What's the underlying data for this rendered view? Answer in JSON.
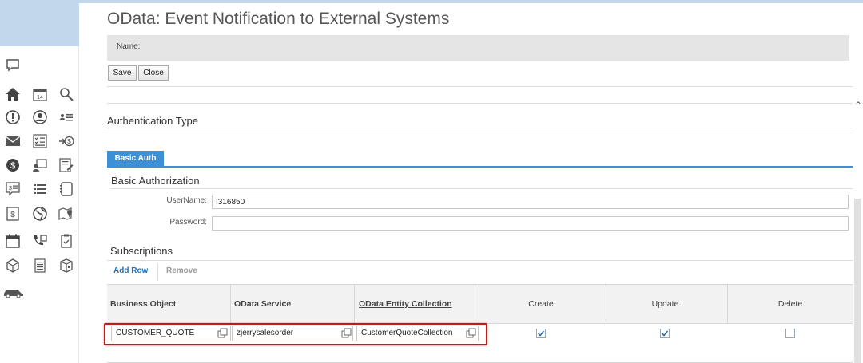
{
  "window": {
    "title": "OData: Event Notification to External Systems",
    "name_label": "Name:"
  },
  "toolbar": {
    "save_label": "Save",
    "close_label": "Close"
  },
  "sections": {
    "auth_type_title": "Authentication Type",
    "tab_label": "Basic Auth",
    "basic_authz_title": "Basic Authorization",
    "subscriptions_title": "Subscriptions"
  },
  "fields": {
    "username_label": "UserName:",
    "username_value": "I316850",
    "password_label": "Password:",
    "password_value": ""
  },
  "subscriptions": {
    "add_row_label": "Add Row",
    "remove_label": "Remove",
    "columns": [
      "Business Object",
      "OData Service",
      "OData Entity Collection",
      "Create",
      "Update",
      "Delete"
    ],
    "rows": [
      {
        "business_object": "CUSTOMER_QUOTE",
        "odata_service": "zjerrysalesorder",
        "entity_collection": "CustomerQuoteCollection",
        "create": true,
        "update": true,
        "delete": false
      }
    ]
  },
  "sidebar": {
    "icons": [
      "chat-icon",
      "home-icon",
      "calendar-icon",
      "search-icon",
      "alert-icon",
      "user-circle-icon",
      "contacts-list-icon",
      "mail-icon",
      "checklist-icon",
      "payment-arrow-icon",
      "dollar-icon",
      "id-card-icon",
      "edit-form-icon",
      "quote-icon",
      "list-icon",
      "notebook-icon",
      "price-icon",
      "globe-icon",
      "map-icon",
      "calendar-grid-icon",
      "phone-icon",
      "clipboard-icon",
      "box-icon",
      "document-icon",
      "package-icon",
      "car-icon"
    ]
  },
  "colors": {
    "accent": "#3d8fd6",
    "highlight": "#c41a1a",
    "sidebar_header": "#c3d7ec"
  }
}
